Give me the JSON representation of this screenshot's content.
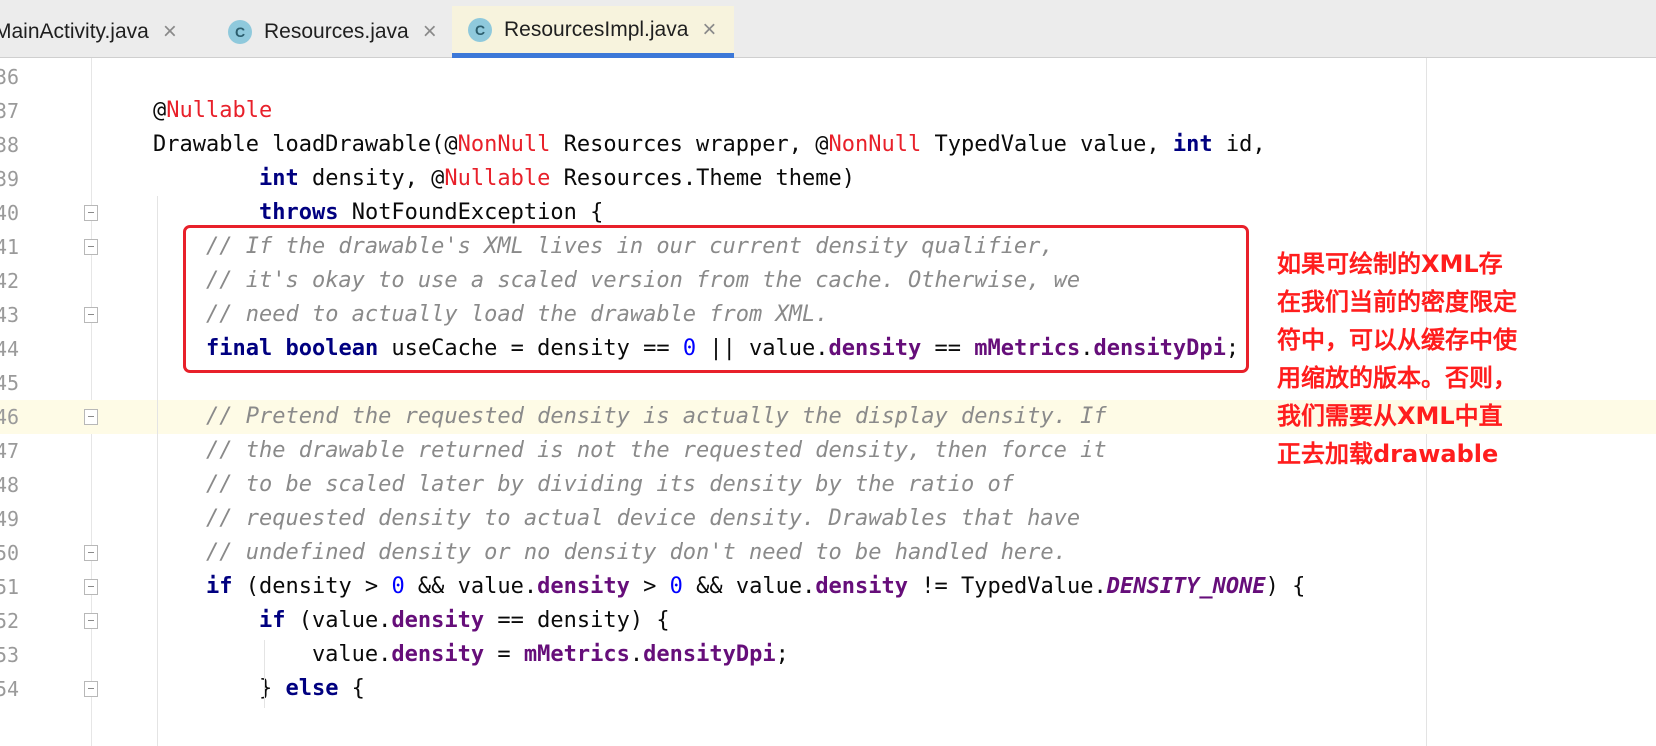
{
  "tabs": [
    {
      "label": "MainActivity.java",
      "icon": "class-file-icon",
      "active": false
    },
    {
      "label": "Resources.java",
      "icon": "class-file-icon",
      "active": false
    },
    {
      "label": "ResourcesImpl.java",
      "icon": "class-file-icon",
      "active": true
    }
  ],
  "tab_icon_letter": "C",
  "tab_close_glyph": "×",
  "editor": {
    "current_line": "46",
    "lines": [
      {
        "num": "36",
        "code": ""
      },
      {
        "num": "37",
        "code": "@Nullable"
      },
      {
        "num": "38",
        "code": "Drawable loadDrawable(@NonNull Resources wrapper, @NonNull TypedValue value, int id,"
      },
      {
        "num": "39",
        "code": "        int density, @Nullable Resources.Theme theme)"
      },
      {
        "num": "40",
        "code": "        throws NotFoundException {"
      },
      {
        "num": "41",
        "code": "    // If the drawable's XML lives in our current density qualifier,"
      },
      {
        "num": "42",
        "code": "    // it's okay to use a scaled version from the cache. Otherwise, we"
      },
      {
        "num": "43",
        "code": "    // need to actually load the drawable from XML."
      },
      {
        "num": "44",
        "code": "    final boolean useCache = density == 0 || value.density == mMetrics.densityDpi;"
      },
      {
        "num": "45",
        "code": ""
      },
      {
        "num": "46",
        "code": "    // Pretend the requested density is actually the display density. If"
      },
      {
        "num": "47",
        "code": "    // the drawable returned is not the requested density, then force it"
      },
      {
        "num": "48",
        "code": "    // to be scaled later by dividing its density by the ratio of"
      },
      {
        "num": "49",
        "code": "    // requested density to actual device density. Drawables that have"
      },
      {
        "num": "50",
        "code": "    // undefined density or no density don't need to be handled here."
      },
      {
        "num": "51",
        "code": "    if (density > 0 && value.density > 0 && value.density != TypedValue.DENSITY_NONE) {"
      },
      {
        "num": "52",
        "code": "        if (value.density == density) {"
      },
      {
        "num": "53",
        "code": "            value.density = mMetrics.densityDpi;"
      },
      {
        "num": "54",
        "code": "        } else {"
      }
    ]
  },
  "annotation": {
    "lines": [
      "如果可绘制的XML存",
      "在我们当前的密度限定",
      "符中，可以从缓存中使",
      "用缩放的版本。否则，",
      "我们需要从XML中直",
      "正去加载drawable"
    ],
    "color": "#ff1d1d"
  },
  "colors": {
    "keyword": "#000080",
    "annotation": "#e8202a",
    "comment": "#8a8a8a",
    "number": "#0000ff",
    "field": "#660e7a",
    "active_tab_underline": "#3c78d8",
    "current_line_bg": "#fefbe6"
  }
}
